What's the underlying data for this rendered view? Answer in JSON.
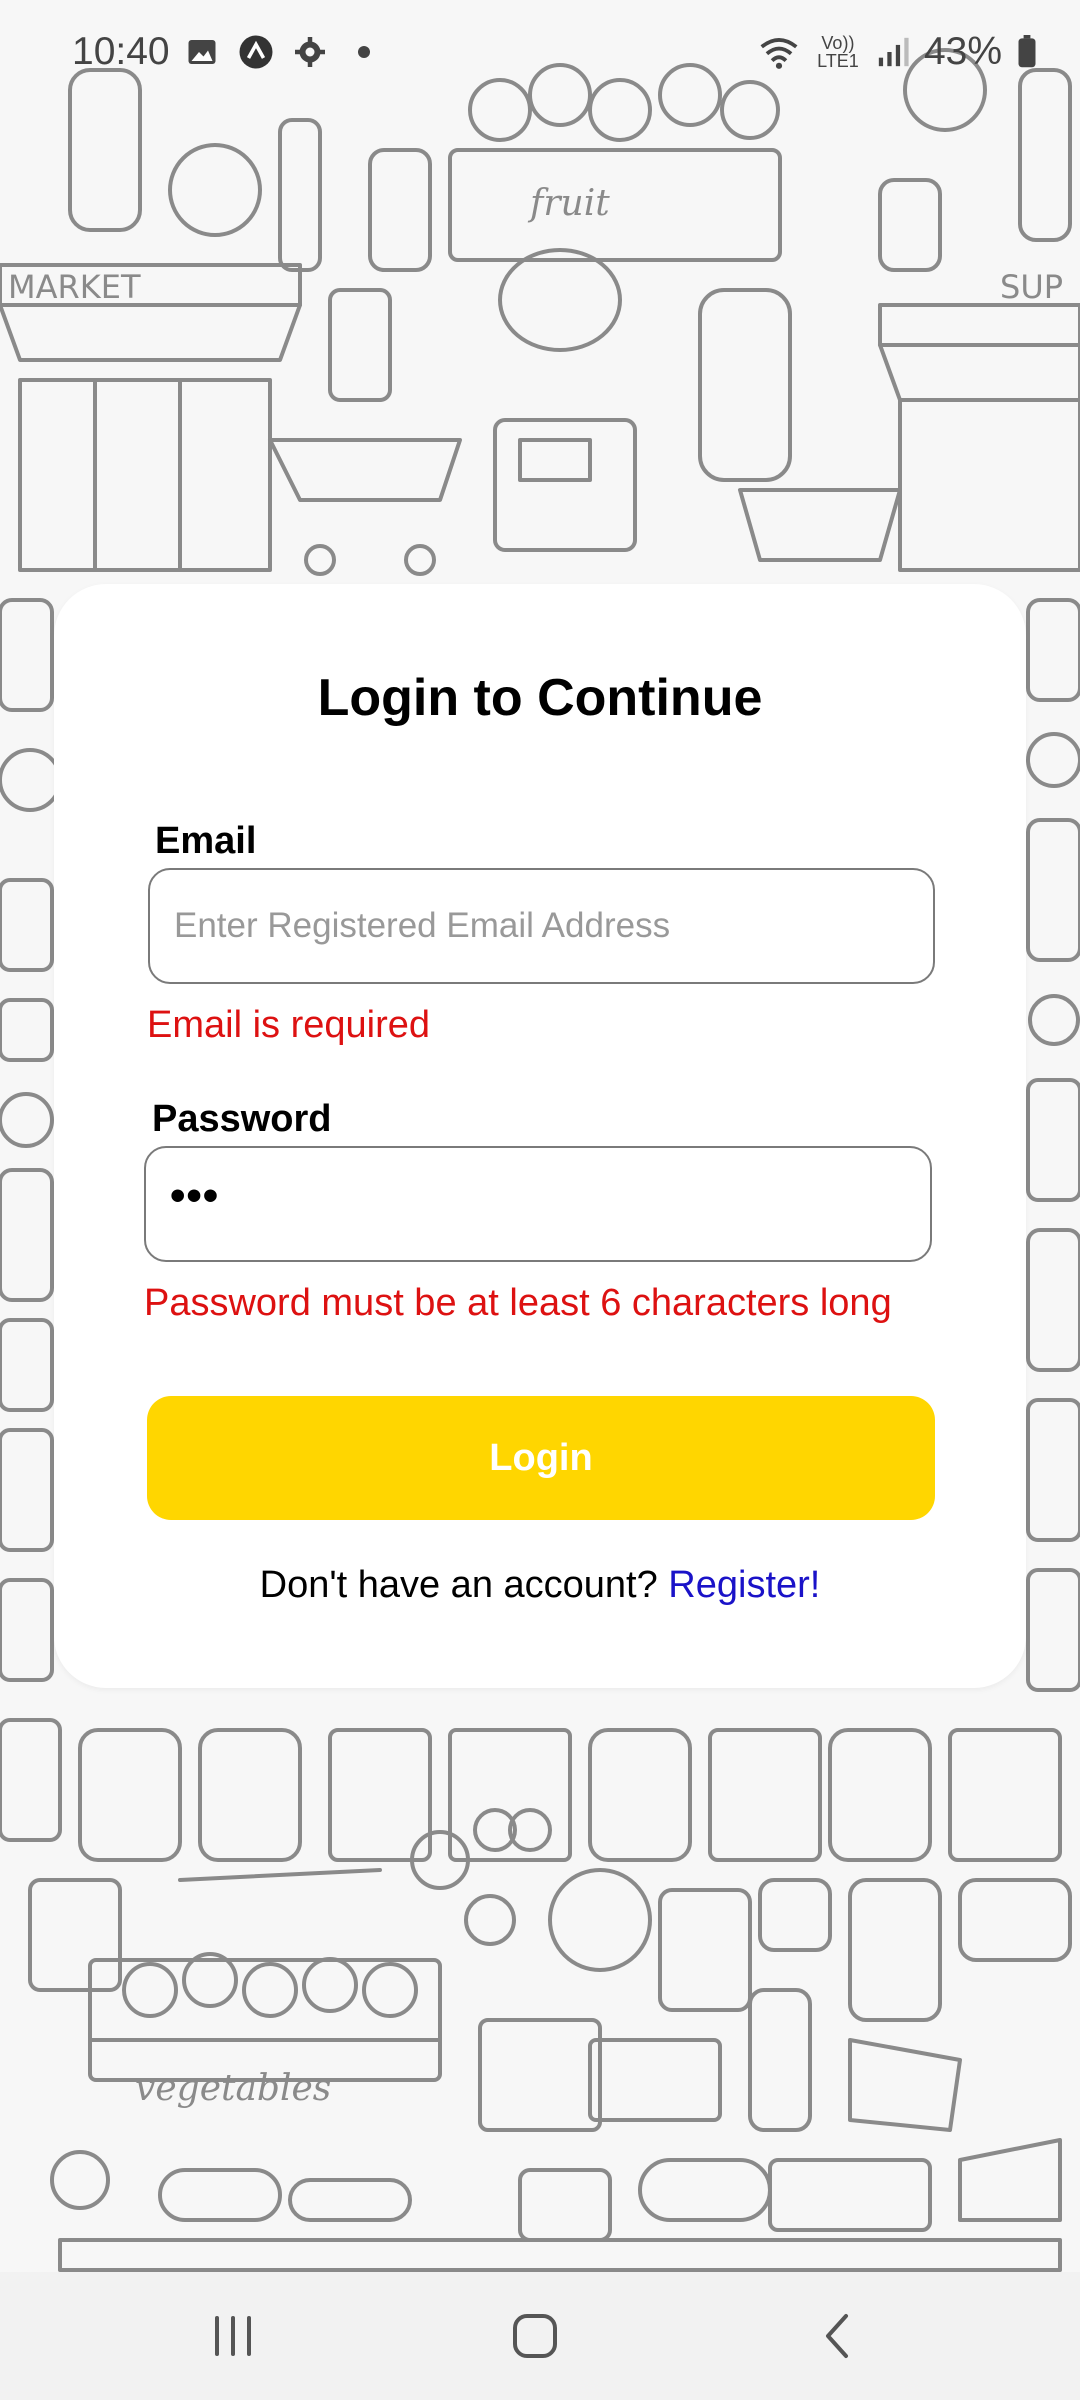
{
  "status_bar": {
    "time": "10:40",
    "left_icons": [
      "gallery-icon",
      "app-icon",
      "settings-icon",
      "dot-icon"
    ],
    "network_label": "Vo)) LTE1",
    "battery": "43%"
  },
  "login": {
    "title": "Login to Continue",
    "email_label": "Email",
    "email_placeholder": "Enter Registered Email Address",
    "email_value": "",
    "email_error": "Email is required",
    "password_label": "Password",
    "password_value_masked": "•••",
    "password_error": "Password must be at least 6 characters long",
    "login_button": "Login",
    "register_prompt": "Don't have an account?",
    "register_link": "Register!"
  },
  "colors": {
    "accent": "#ffd600",
    "error": "#dd1111",
    "link": "#1a12c8"
  },
  "nav_bar": {
    "items": [
      "recent-apps-icon",
      "home-icon",
      "back-icon"
    ]
  }
}
